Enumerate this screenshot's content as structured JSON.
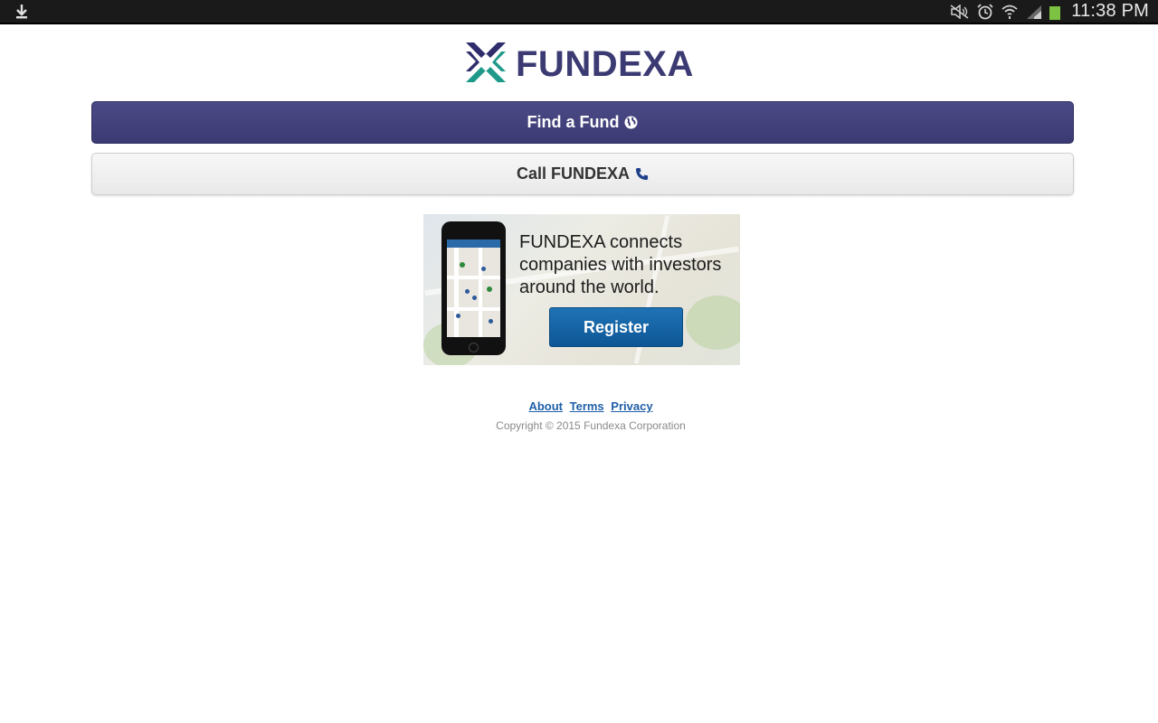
{
  "status_bar": {
    "time": "11:38 PM",
    "icons": [
      "download-icon",
      "mute-icon",
      "alarm-icon",
      "wifi-icon",
      "signal-icon",
      "battery-icon"
    ]
  },
  "header": {
    "logo_text": "FUNDEXA",
    "logo_colors": {
      "dark": "#2f2d6b",
      "teal": "#1f9a8a",
      "text": "#3c3a72"
    }
  },
  "actions": {
    "find_fund_label": "Find a Fund",
    "find_fund_icon": "globe-icon",
    "call_label": "Call FUNDEXA",
    "call_icon": "phone-icon"
  },
  "promo": {
    "text": "FUNDEXA connects companies with investors around the world.",
    "register_label": "Register"
  },
  "footer": {
    "links": [
      "About",
      "Terms",
      "Privacy"
    ],
    "copyright": "Copyright © 2015 Fundexa Corporation"
  },
  "colors": {
    "primary": "#3b3a73",
    "register": "#11599a",
    "link": "#1f5fa8"
  }
}
